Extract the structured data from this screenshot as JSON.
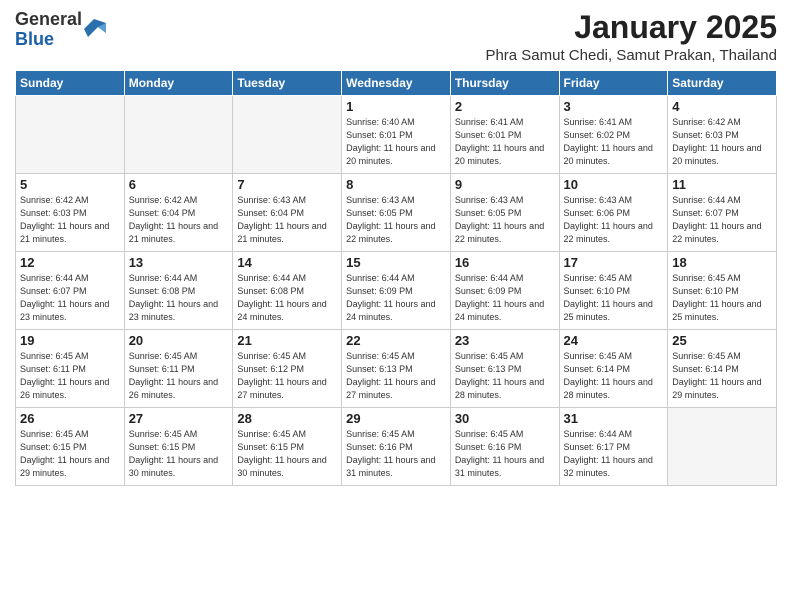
{
  "logo": {
    "general": "General",
    "blue": "Blue"
  },
  "title": "January 2025",
  "subtitle": "Phra Samut Chedi, Samut Prakan, Thailand",
  "weekdays": [
    "Sunday",
    "Monday",
    "Tuesday",
    "Wednesday",
    "Thursday",
    "Friday",
    "Saturday"
  ],
  "weeks": [
    [
      {
        "day": "",
        "info": ""
      },
      {
        "day": "",
        "info": ""
      },
      {
        "day": "",
        "info": ""
      },
      {
        "day": "1",
        "info": "Sunrise: 6:40 AM\nSunset: 6:01 PM\nDaylight: 11 hours and 20 minutes."
      },
      {
        "day": "2",
        "info": "Sunrise: 6:41 AM\nSunset: 6:01 PM\nDaylight: 11 hours and 20 minutes."
      },
      {
        "day": "3",
        "info": "Sunrise: 6:41 AM\nSunset: 6:02 PM\nDaylight: 11 hours and 20 minutes."
      },
      {
        "day": "4",
        "info": "Sunrise: 6:42 AM\nSunset: 6:03 PM\nDaylight: 11 hours and 20 minutes."
      }
    ],
    [
      {
        "day": "5",
        "info": "Sunrise: 6:42 AM\nSunset: 6:03 PM\nDaylight: 11 hours and 21 minutes."
      },
      {
        "day": "6",
        "info": "Sunrise: 6:42 AM\nSunset: 6:04 PM\nDaylight: 11 hours and 21 minutes."
      },
      {
        "day": "7",
        "info": "Sunrise: 6:43 AM\nSunset: 6:04 PM\nDaylight: 11 hours and 21 minutes."
      },
      {
        "day": "8",
        "info": "Sunrise: 6:43 AM\nSunset: 6:05 PM\nDaylight: 11 hours and 22 minutes."
      },
      {
        "day": "9",
        "info": "Sunrise: 6:43 AM\nSunset: 6:05 PM\nDaylight: 11 hours and 22 minutes."
      },
      {
        "day": "10",
        "info": "Sunrise: 6:43 AM\nSunset: 6:06 PM\nDaylight: 11 hours and 22 minutes."
      },
      {
        "day": "11",
        "info": "Sunrise: 6:44 AM\nSunset: 6:07 PM\nDaylight: 11 hours and 22 minutes."
      }
    ],
    [
      {
        "day": "12",
        "info": "Sunrise: 6:44 AM\nSunset: 6:07 PM\nDaylight: 11 hours and 23 minutes."
      },
      {
        "day": "13",
        "info": "Sunrise: 6:44 AM\nSunset: 6:08 PM\nDaylight: 11 hours and 23 minutes."
      },
      {
        "day": "14",
        "info": "Sunrise: 6:44 AM\nSunset: 6:08 PM\nDaylight: 11 hours and 24 minutes."
      },
      {
        "day": "15",
        "info": "Sunrise: 6:44 AM\nSunset: 6:09 PM\nDaylight: 11 hours and 24 minutes."
      },
      {
        "day": "16",
        "info": "Sunrise: 6:44 AM\nSunset: 6:09 PM\nDaylight: 11 hours and 24 minutes."
      },
      {
        "day": "17",
        "info": "Sunrise: 6:45 AM\nSunset: 6:10 PM\nDaylight: 11 hours and 25 minutes."
      },
      {
        "day": "18",
        "info": "Sunrise: 6:45 AM\nSunset: 6:10 PM\nDaylight: 11 hours and 25 minutes."
      }
    ],
    [
      {
        "day": "19",
        "info": "Sunrise: 6:45 AM\nSunset: 6:11 PM\nDaylight: 11 hours and 26 minutes."
      },
      {
        "day": "20",
        "info": "Sunrise: 6:45 AM\nSunset: 6:11 PM\nDaylight: 11 hours and 26 minutes."
      },
      {
        "day": "21",
        "info": "Sunrise: 6:45 AM\nSunset: 6:12 PM\nDaylight: 11 hours and 27 minutes."
      },
      {
        "day": "22",
        "info": "Sunrise: 6:45 AM\nSunset: 6:13 PM\nDaylight: 11 hours and 27 minutes."
      },
      {
        "day": "23",
        "info": "Sunrise: 6:45 AM\nSunset: 6:13 PM\nDaylight: 11 hours and 28 minutes."
      },
      {
        "day": "24",
        "info": "Sunrise: 6:45 AM\nSunset: 6:14 PM\nDaylight: 11 hours and 28 minutes."
      },
      {
        "day": "25",
        "info": "Sunrise: 6:45 AM\nSunset: 6:14 PM\nDaylight: 11 hours and 29 minutes."
      }
    ],
    [
      {
        "day": "26",
        "info": "Sunrise: 6:45 AM\nSunset: 6:15 PM\nDaylight: 11 hours and 29 minutes."
      },
      {
        "day": "27",
        "info": "Sunrise: 6:45 AM\nSunset: 6:15 PM\nDaylight: 11 hours and 30 minutes."
      },
      {
        "day": "28",
        "info": "Sunrise: 6:45 AM\nSunset: 6:15 PM\nDaylight: 11 hours and 30 minutes."
      },
      {
        "day": "29",
        "info": "Sunrise: 6:45 AM\nSunset: 6:16 PM\nDaylight: 11 hours and 31 minutes."
      },
      {
        "day": "30",
        "info": "Sunrise: 6:45 AM\nSunset: 6:16 PM\nDaylight: 11 hours and 31 minutes."
      },
      {
        "day": "31",
        "info": "Sunrise: 6:44 AM\nSunset: 6:17 PM\nDaylight: 11 hours and 32 minutes."
      },
      {
        "day": "",
        "info": ""
      }
    ]
  ]
}
